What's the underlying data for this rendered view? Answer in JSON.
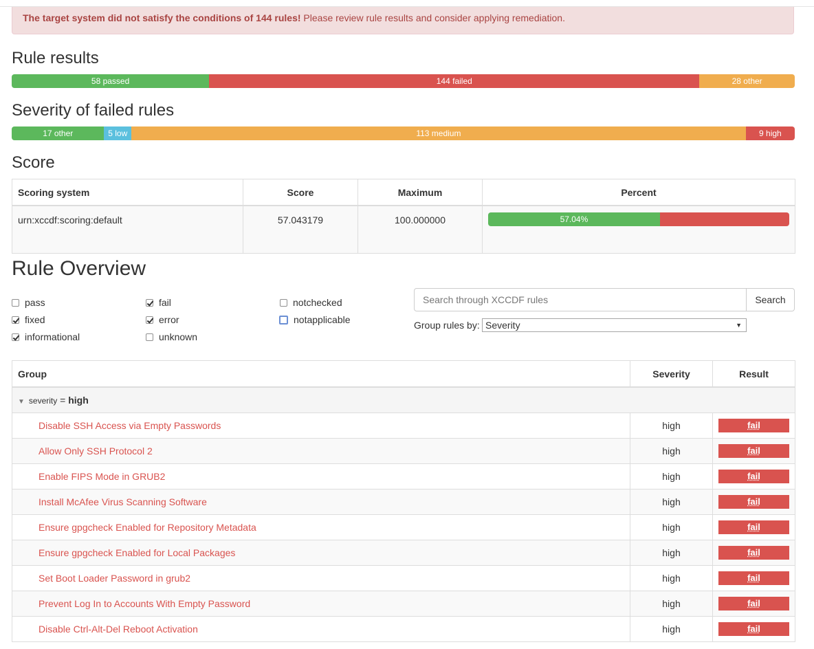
{
  "alert": {
    "bold": "The target system did not satisfy the conditions of 144 rules!",
    "text": " Please review rule results and consider applying remediation."
  },
  "rule_results": {
    "title": "Rule results",
    "segments": [
      {
        "label": "58 passed",
        "value": 58,
        "color": "#5cb85c"
      },
      {
        "label": "144 failed",
        "value": 144,
        "color": "#d9534f"
      },
      {
        "label": "28 other",
        "value": 28,
        "color": "#f0ad4e"
      }
    ]
  },
  "severity": {
    "title": "Severity of failed rules",
    "segments": [
      {
        "label": "17 other",
        "value": 17,
        "color": "#5cb85c"
      },
      {
        "label": "5 low",
        "value": 5,
        "color": "#5bc0de"
      },
      {
        "label": "113 medium",
        "value": 113,
        "color": "#f0ad4e"
      },
      {
        "label": "9 high",
        "value": 9,
        "color": "#d9534f"
      }
    ]
  },
  "score": {
    "title": "Score",
    "headers": [
      "Scoring system",
      "Score",
      "Maximum",
      "Percent"
    ],
    "system": "urn:xccdf:scoring:default",
    "score": "57.043179",
    "maximum": "100.000000",
    "percent_label": "57.04%",
    "percent": 57.04
  },
  "overview": {
    "title": "Rule Overview",
    "filters": [
      {
        "label": "pass",
        "checked": false
      },
      {
        "label": "fixed",
        "checked": true
      },
      {
        "label": "informational",
        "checked": true
      },
      {
        "label": "fail",
        "checked": true
      },
      {
        "label": "error",
        "checked": true
      },
      {
        "label": "unknown",
        "checked": false
      },
      {
        "label": "notchecked",
        "checked": false
      },
      {
        "label": "notapplicable",
        "checked": false
      }
    ],
    "search_placeholder": "Search through XCCDF rules",
    "search_button": "Search",
    "group_label": "Group rules by:",
    "group_value": "Severity"
  },
  "rules_table": {
    "headers": [
      "Group",
      "Severity",
      "Result"
    ],
    "group_key": "severity",
    "group_eq": "=",
    "group_value": "high",
    "rows": [
      {
        "title": "Disable SSH Access via Empty Passwords",
        "severity": "high",
        "result": "fail"
      },
      {
        "title": "Allow Only SSH Protocol 2",
        "severity": "high",
        "result": "fail"
      },
      {
        "title": "Enable FIPS Mode in GRUB2",
        "severity": "high",
        "result": "fail"
      },
      {
        "title": "Install McAfee Virus Scanning Software",
        "severity": "high",
        "result": "fail"
      },
      {
        "title": "Ensure gpgcheck Enabled for Repository Metadata",
        "severity": "high",
        "result": "fail"
      },
      {
        "title": "Ensure gpgcheck Enabled for Local Packages",
        "severity": "high",
        "result": "fail"
      },
      {
        "title": "Set Boot Loader Password in grub2",
        "severity": "high",
        "result": "fail"
      },
      {
        "title": "Prevent Log In to Accounts With Empty Password",
        "severity": "high",
        "result": "fail"
      },
      {
        "title": "Disable Ctrl-Alt-Del Reboot Activation",
        "severity": "high",
        "result": "fail"
      }
    ]
  }
}
